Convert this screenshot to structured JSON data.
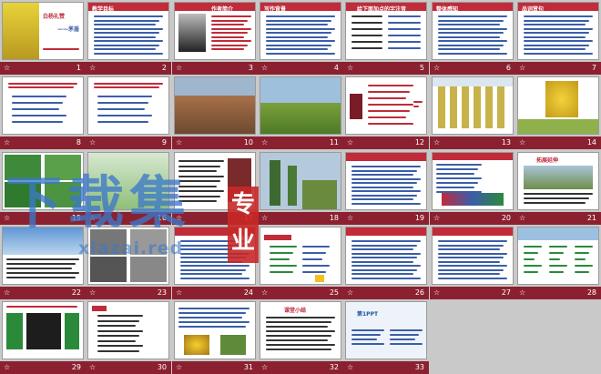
{
  "app": "slide sorter",
  "watermark": {
    "main": "下载集",
    "badge": "专业",
    "url": "xiazai.red"
  },
  "slides": [
    {
      "n": "1",
      "kind": "cover",
      "title": "白杨礼赞",
      "sub": "——茅盾"
    },
    {
      "n": "2",
      "kind": "text",
      "title": "教学目标"
    },
    {
      "n": "3",
      "kind": "portrait",
      "title": "作者简介"
    },
    {
      "n": "4",
      "kind": "text",
      "title": "写作背景"
    },
    {
      "n": "5",
      "kind": "table",
      "title": "给下面加点的字注音"
    },
    {
      "n": "6",
      "kind": "text",
      "title": "整体感知"
    },
    {
      "n": "7",
      "kind": "text",
      "title": "品词赏句"
    },
    {
      "n": "8",
      "kind": "bluetext"
    },
    {
      "n": "9",
      "kind": "bluetext"
    },
    {
      "n": "10",
      "kind": "canyon"
    },
    {
      "n": "11",
      "kind": "plain"
    },
    {
      "n": "12",
      "kind": "diagram"
    },
    {
      "n": "13",
      "kind": "trees"
    },
    {
      "n": "14",
      "kind": "yellowtree"
    },
    {
      "n": "15",
      "kind": "greenphotos"
    },
    {
      "n": "16",
      "kind": "leaves"
    },
    {
      "n": "17",
      "kind": "textphoto"
    },
    {
      "n": "18",
      "kind": "poplars"
    },
    {
      "n": "19",
      "kind": "text"
    },
    {
      "n": "20",
      "kind": "textstrip"
    },
    {
      "n": "21",
      "kind": "scenery",
      "title": "拓展延伸"
    },
    {
      "n": "22",
      "kind": "sky"
    },
    {
      "n": "23",
      "kind": "bwphotos"
    },
    {
      "n": "24",
      "kind": "text"
    },
    {
      "n": "25",
      "kind": "mindmap"
    },
    {
      "n": "26",
      "kind": "text"
    },
    {
      "n": "27",
      "kind": "text"
    },
    {
      "n": "28",
      "kind": "treemap"
    },
    {
      "n": "29",
      "kind": "boxes"
    },
    {
      "n": "30",
      "kind": "outline"
    },
    {
      "n": "31",
      "kind": "flowers"
    },
    {
      "n": "32",
      "kind": "poem",
      "title": "课堂小结"
    },
    {
      "n": "33",
      "kind": "ppt",
      "title": "第1PPT"
    }
  ]
}
